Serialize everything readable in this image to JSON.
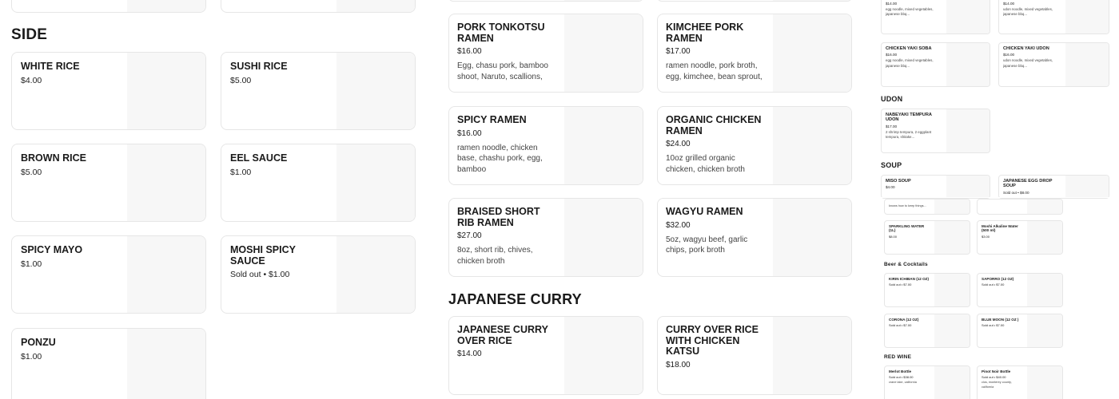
{
  "panel_left": {
    "section_title": "SIDE",
    "items": [
      {
        "name": "WHITE RICE",
        "price": "$4.00"
      },
      {
        "name": "SUSHI RICE",
        "price": "$5.00"
      },
      {
        "name": "BROWN RICE",
        "price": "$5.00"
      },
      {
        "name": "EEL SAUCE",
        "price": "$1.00"
      },
      {
        "name": "SPICY MAYO",
        "price": "$1.00"
      },
      {
        "name": "MOSHI SPICY SAUCE",
        "price": "Sold out • $1.00"
      },
      {
        "name": "PONZU",
        "price": "$1.00"
      }
    ]
  },
  "panel_middle": {
    "ramen_items": [
      {
        "name": "PORK TONKOTSU RAMEN",
        "price": "$16.00",
        "desc": "Egg, chasu pork, bamboo shoot, Naruto, scallions,"
      },
      {
        "name": "KIMCHEE PORK RAMEN",
        "price": "$17.00",
        "desc": "ramen noodle, pork broth, egg, kimchee, bean sprout,"
      },
      {
        "name": "SPICY RAMEN",
        "price": "$16.00",
        "desc": "ramen noodle, chicken base, chashu pork, egg, bamboo"
      },
      {
        "name": "ORGANIC CHICKEN RAMEN",
        "price": "$24.00",
        "desc": "10oz grilled organic chicken, chicken broth"
      },
      {
        "name": "BRAISED SHORT RIB RAMEN",
        "price": "$27.00",
        "desc": "8oz, short rib, chives, chicken broth"
      },
      {
        "name": "WAGYU RAMEN",
        "price": "$32.00",
        "desc": "5oz, wagyu beef, garlic chips, pork broth"
      }
    ],
    "section_title": "JAPANESE CURRY",
    "curry_items": [
      {
        "name": "JAPANESE CURRY OVER RICE",
        "price": "$14.00"
      },
      {
        "name": "CURRY OVER RICE WITH CHICKEN KATSU",
        "price": "$18.00"
      }
    ]
  },
  "panel_right": {
    "top_items": [
      {
        "name": "",
        "price": "$14.00",
        "desc": "egg noodle, mixed vegetables, japanese bbq..."
      },
      {
        "name": "",
        "price": "$14.00",
        "desc": "udon noodle, mixed vegetables, japanese bbq..."
      },
      {
        "name": "CHICKEN YAKI SOBA",
        "price": "$16.00",
        "desc": "egg noodle, mixed vegetables, japanese bbq..."
      },
      {
        "name": "CHICKEN YAKI UDON",
        "price": "$16.00",
        "desc": "udon noodle, mixed vegetables, japanese bbq..."
      }
    ],
    "udon_title": "UDON",
    "udon_items": [
      {
        "name": "NABEYAKI TEMPURA UDON",
        "price": "$17.00",
        "desc": "2 shrimp tempura, 2 eggplant tempura, shitake..."
      }
    ],
    "soup_title": "SOUP",
    "soup_items": [
      {
        "name": "MISO SOUP",
        "price": "$4.00"
      },
      {
        "name": "JAPANESE EGG DROP SOUP",
        "price": "Sold out • $8.00"
      }
    ],
    "drinks_top": [
      {
        "name": "",
        "price": "",
        "desc": "knows how to keep things..."
      }
    ],
    "water_items": [
      {
        "name": "SPARKLING WATER (1L)",
        "price": "$8.00"
      },
      {
        "name": "Moshi Alkaline Water (500 ml)",
        "price": "$3.00"
      }
    ],
    "beer_title": "Beer & Cocktails",
    "beer_items": [
      {
        "name": "KIRIN ICHIBAN (12 OZ)",
        "price": "Sold out • $7.00"
      },
      {
        "name": "SAPORRO (12 OZ)",
        "price": "Sold out • $7.00"
      },
      {
        "name": "CORONA (12 OZ)",
        "price": "Sold out • $7.00"
      },
      {
        "name": "BLUE MOON (12 OZ )",
        "price": "Sold out • $7.00"
      }
    ],
    "wine_title": "RED WINE",
    "wine_items": [
      {
        "name": "Merlot Bottle",
        "price": "Sold out • $38.00",
        "desc": "crane lake, california"
      },
      {
        "name": "Pinot Noir Bottle",
        "price": "Sold out • $40.00",
        "desc": "clos, monterey county, california"
      }
    ]
  }
}
